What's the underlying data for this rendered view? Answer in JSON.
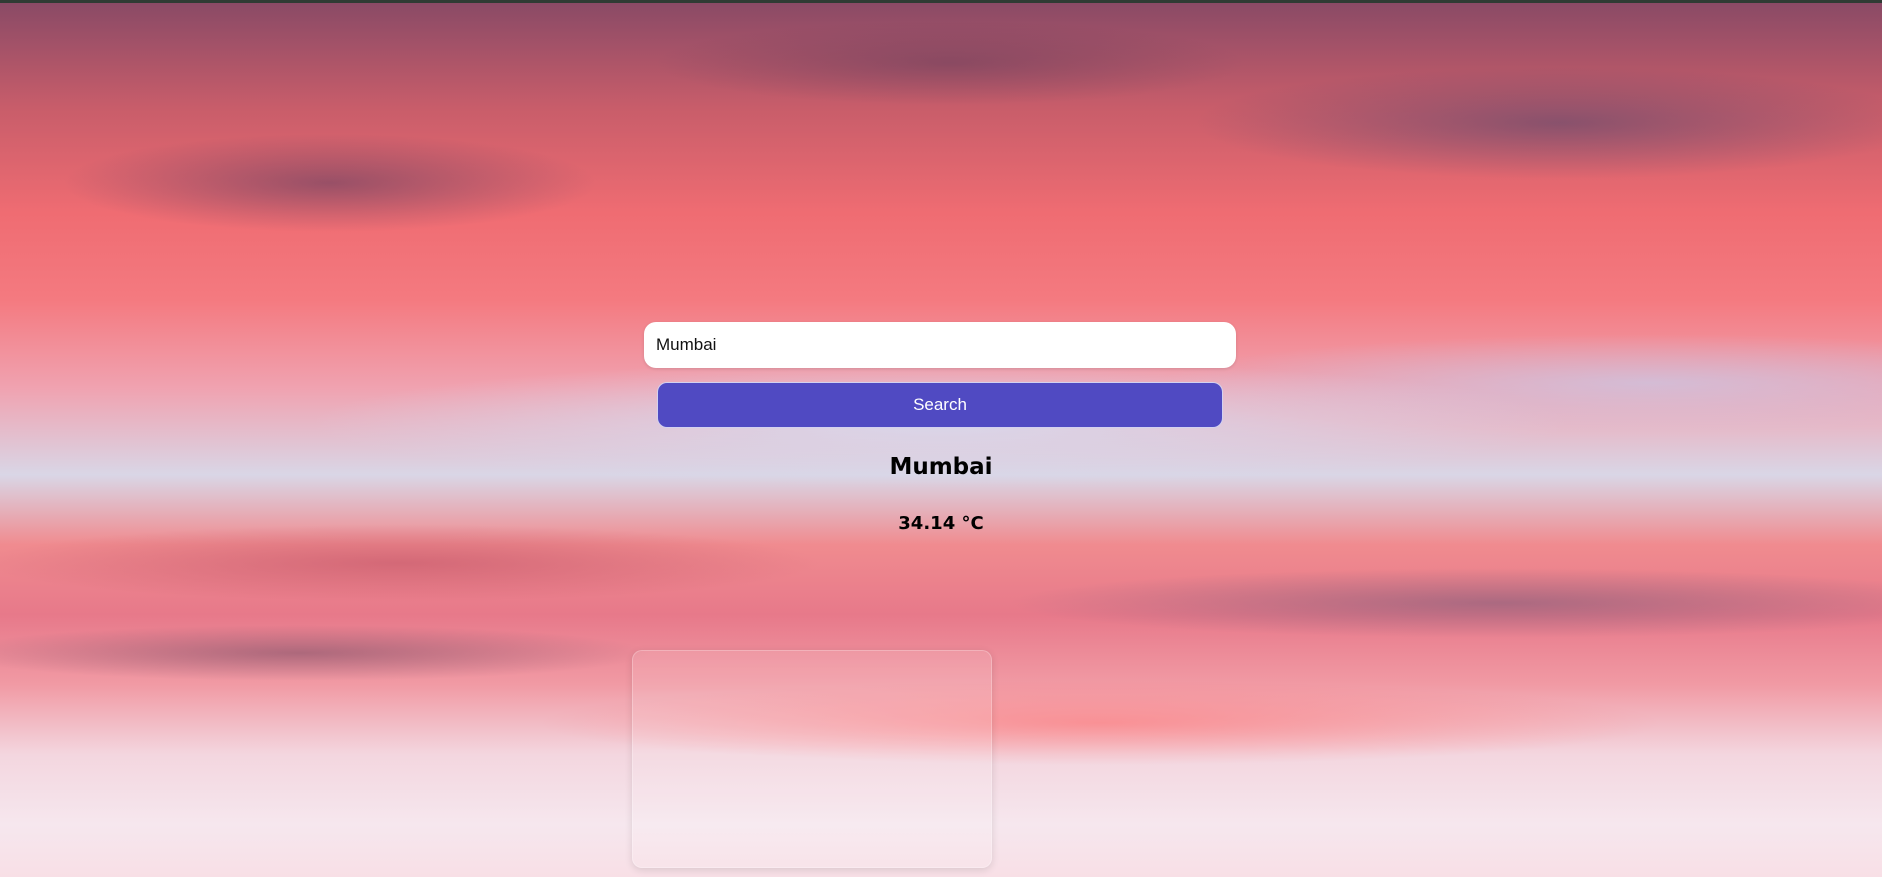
{
  "search": {
    "value": "Mumbai"
  },
  "search_button": {
    "label": "Search",
    "color": "#504ac2"
  },
  "weather": {
    "city": "Mumbai",
    "temperature": "34.14 °C"
  }
}
